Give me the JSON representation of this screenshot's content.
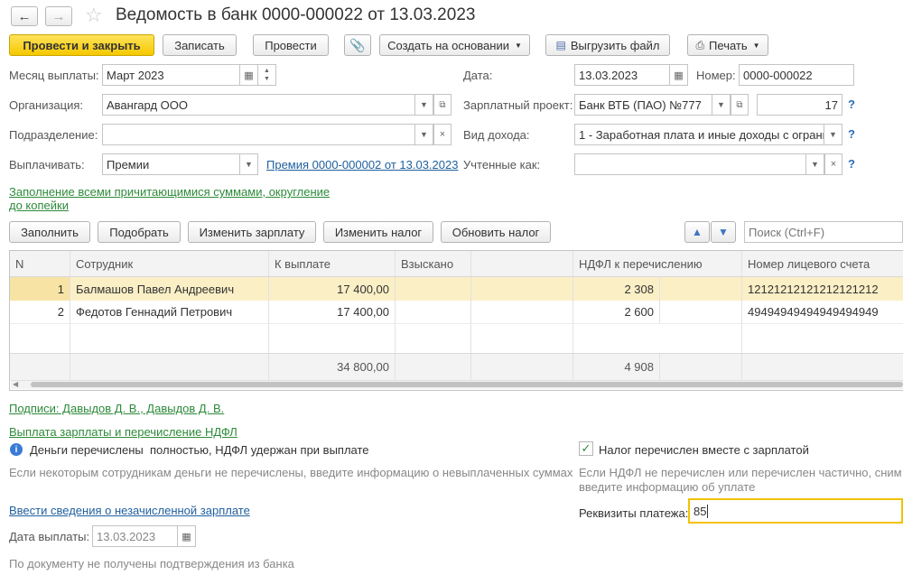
{
  "title": "Ведомость в банк 0000-000022 от 13.03.2023",
  "toolbar": {
    "post_close": "Провести и закрыть",
    "save": "Записать",
    "post": "Провести",
    "create_based": "Создать на основании",
    "export_file": "Выгрузить файл",
    "print": "Печать"
  },
  "form": {
    "pay_month_label": "Месяц выплаты:",
    "pay_month_value": "Март 2023",
    "date_label": "Дата:",
    "date_value": "13.03.2023",
    "number_label": "Номер:",
    "number_value": "0000-000022",
    "org_label": "Организация:",
    "org_value": "Авангард ООО",
    "salary_project_label": "Зарплатный проект:",
    "salary_project_value": "Банк ВТБ (ПАО) №777",
    "salary_project_code": "17",
    "dept_label": "Подразделение:",
    "dept_value": "",
    "income_type_label": "Вид дохода:",
    "income_type_value": "1 - Заработная плата и иные доходы с ограни",
    "pay_label": "Выплачивать:",
    "pay_value": "Премии",
    "premium_link": "Премия 0000-000002 от 13.03.2023",
    "accounted_label": "Учтенные как:",
    "accounted_value": "",
    "fill_link_1": "Заполнение всеми причитающимися суммами, округление",
    "fill_link_2": "до копейки",
    "qmark": "?"
  },
  "table_toolbar": {
    "fill": "Заполнить",
    "pick": "Подобрать",
    "change_salary": "Изменить зарплату",
    "change_tax": "Изменить налог",
    "update_tax": "Обновить налог",
    "search_placeholder": "Поиск (Ctrl+F)"
  },
  "table": {
    "headers": [
      "N",
      "Сотрудник",
      "К выплате",
      "Взыскано",
      "НДФЛ к перечислению",
      "Номер лицевого счета"
    ],
    "rows": [
      {
        "n": "1",
        "employee": "Балмашов Павел Андреевич",
        "amount": "17 400,00",
        "withheld": "",
        "ndfl": "2 308",
        "account": "12121212121212121212"
      },
      {
        "n": "2",
        "employee": "Федотов Геннадий Петрович",
        "amount": "17 400,00",
        "withheld": "",
        "ndfl": "2 600",
        "account": "49494949494949494949"
      }
    ],
    "totals": {
      "amount": "34 800,00",
      "ndfl": "4 908"
    }
  },
  "footer": {
    "signatures_link": "Подписи: Давыдов Д. В., Давыдов Д. В.",
    "payout_link": "Выплата зарплаты и перечисление НДФЛ",
    "money_status_bold": "Деньги перечислены",
    "money_status_rest": "полностью, НДФЛ удержан при выплате",
    "money_hint": "Если некоторым сотрудникам деньги не перечислены, введите информацию о невыплаченных суммах",
    "tax_checkbox_label": "Налог перечислен вместе с зарплатой",
    "tax_hint_1": "Если НДФЛ не перечислен или перечислен частично, сним",
    "tax_hint_2": "введите информацию об уплате",
    "unpaid_link": "Ввести сведения о незачисленной зарплате",
    "payment_details_label": "Реквизиты платежа:",
    "payment_details_value": "85",
    "payout_date_label": "Дата выплаты:",
    "payout_date_value": "13.03.2023",
    "bank_status": "По документу не получены подтверждения из банка"
  },
  "colors": {
    "primary": "#f5c800",
    "link": "#1f5f9e",
    "green_link": "#2d8a3a",
    "selection": "#fbefc6"
  }
}
